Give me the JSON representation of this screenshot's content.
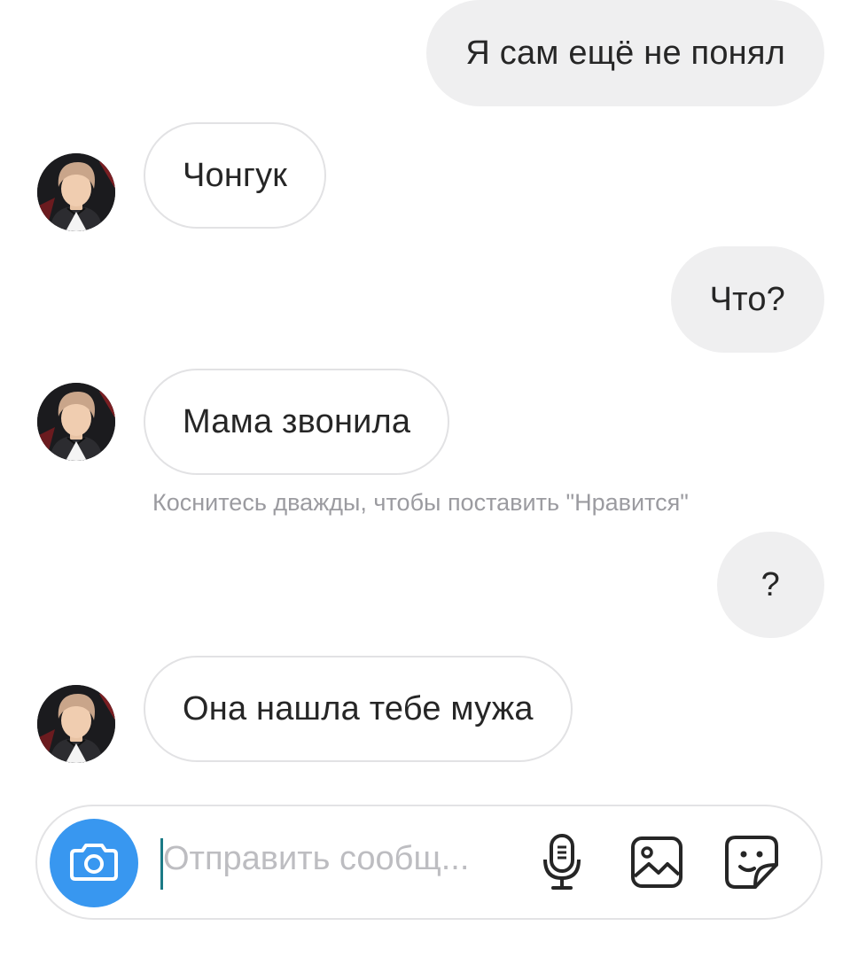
{
  "messages": [
    {
      "direction": "out",
      "text": "Я сам ещё не понял"
    },
    {
      "direction": "in",
      "text": "Чонгук"
    },
    {
      "direction": "out",
      "text": "Что?"
    },
    {
      "direction": "in",
      "text": "Мама звонила"
    },
    {
      "direction": "out",
      "text": "?"
    },
    {
      "direction": "in",
      "text": "Она нашла тебе мужа"
    }
  ],
  "like_hint": "Коснитесь дважды, чтобы поставить \"Нравится\"",
  "composer": {
    "placeholder": "Отправить сообщ...",
    "left_button_icon": "camera-icon",
    "tools": [
      "microphone-icon",
      "gallery-icon",
      "sticker-icon"
    ],
    "accent_color": "#3897f0"
  },
  "colors": {
    "outgoing_bubble": "#efeff0",
    "incoming_border": "#e2e2e4",
    "hint_text": "#9b9ba0"
  }
}
